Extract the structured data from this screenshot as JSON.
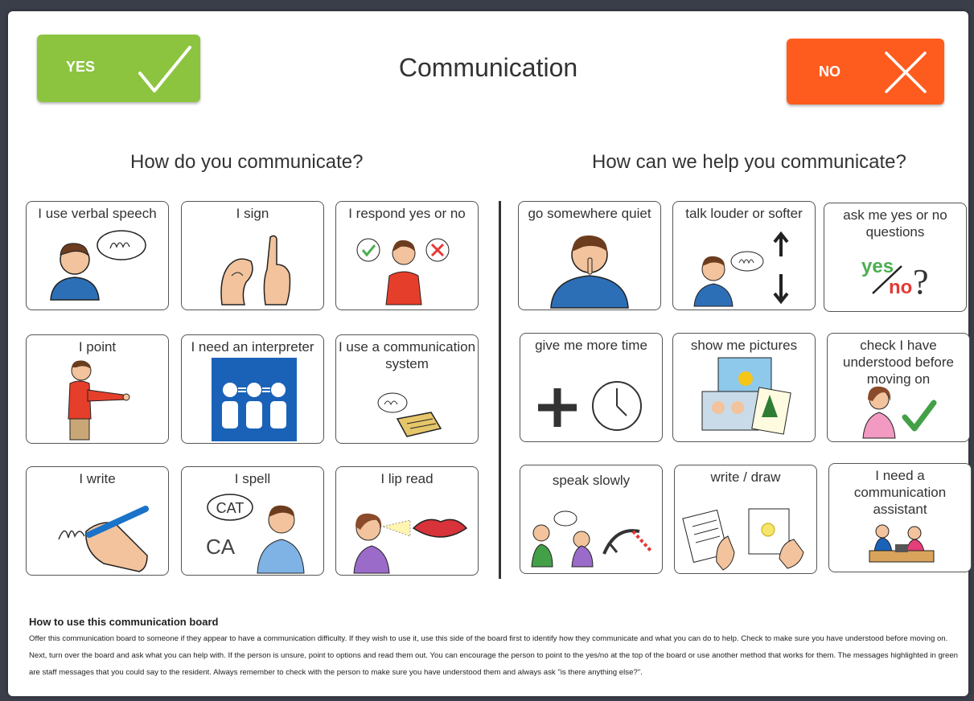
{
  "header": {
    "yes_label": "YES",
    "no_label": "NO",
    "title": "Communication",
    "colors": {
      "yes": "#8cc43f",
      "no": "#fe5c1e"
    }
  },
  "left_section": {
    "heading": "How do you communicate?",
    "cards": [
      {
        "label": "I use verbal speech",
        "icon": "speaking-person-icon"
      },
      {
        "label": "I sign",
        "icon": "signing-hands-icon"
      },
      {
        "label": "I respond yes or no",
        "icon": "yes-no-thinking-icon"
      },
      {
        "label": "I point",
        "icon": "pointing-person-icon"
      },
      {
        "label": "I need an interpreter",
        "icon": "interpreter-icon"
      },
      {
        "label": "I use a communication system",
        "icon": "communication-device-icon"
      },
      {
        "label": "I write",
        "icon": "writing-hand-icon"
      },
      {
        "label": "I spell",
        "icon": "spelling-person-icon",
        "speech": "CAT"
      },
      {
        "label": "I lip read",
        "icon": "lip-reading-icon"
      }
    ]
  },
  "right_section": {
    "heading": "How can we help you communicate?",
    "cards": [
      {
        "label": "go somewhere quiet",
        "icon": "shush-person-icon"
      },
      {
        "label": "talk louder or softer",
        "icon": "volume-arrows-icon"
      },
      {
        "label": "ask me yes or no questions",
        "icon": "yes-no-question-icon",
        "yes": "yes",
        "no": "no"
      },
      {
        "label": "give me more time",
        "icon": "plus-clock-icon"
      },
      {
        "label": "show me pictures",
        "icon": "pictures-icon"
      },
      {
        "label": "check I have understood before moving on",
        "icon": "check-understood-icon"
      },
      {
        "label": "speak slowly",
        "icon": "speak-slowly-icon"
      },
      {
        "label": "write / draw",
        "icon": "write-draw-icon"
      },
      {
        "label": "I need a communication assistant",
        "icon": "assistant-icon"
      }
    ]
  },
  "instructions": {
    "title": "How to use this communication board",
    "text": "Offer this communication board to someone if they appear to have a communication difficulty. If they wish to use it, use this side of the board first to identify how they communicate and what you can do to help. Check to make sure you have understood before moving on. Next, turn over the board and ask what you can help with. If the person is unsure, point to options and read them out. You can encourage the person to point to the yes/no at the top of the board or use another method that works for them. The messages highlighted in green are staff messages that you could say to the resident. Always remember to check with the person to make sure you have understood them and always ask \"is there anything else?\"."
  }
}
